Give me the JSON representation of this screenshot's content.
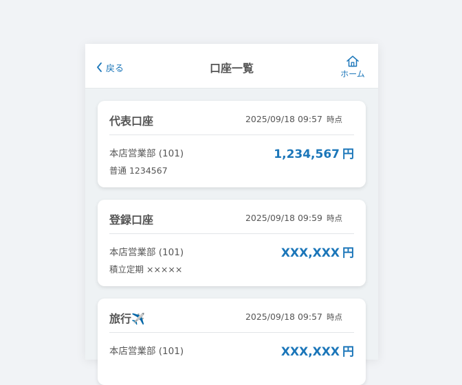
{
  "header": {
    "back_label": "戻る",
    "title": "口座一覧",
    "home_label": "ホーム"
  },
  "accounts": [
    {
      "name": "代表口座",
      "timestamp": "2025/09/18 09:57",
      "timestamp_suffix": "時点",
      "branch": "本店営業部 (101)",
      "account": "普通 1234567",
      "amount": "1,234,567",
      "unit": "円"
    },
    {
      "name": "登録口座",
      "timestamp": "2025/09/18 09:59",
      "timestamp_suffix": "時点",
      "branch": "本店営業部 (101)",
      "account": "積立定期 ×××××",
      "amount": "XXX,XXX",
      "unit": "円"
    },
    {
      "name": "旅行✈️",
      "timestamp": "2025/09/18 09:57",
      "timestamp_suffix": "時点",
      "branch": "本店営業部 (101)",
      "account": "",
      "amount": "XXX,XXX",
      "unit": "円"
    }
  ],
  "colors": {
    "accent": "#1b76b9",
    "text": "#555555",
    "background": "#eef2f4"
  }
}
